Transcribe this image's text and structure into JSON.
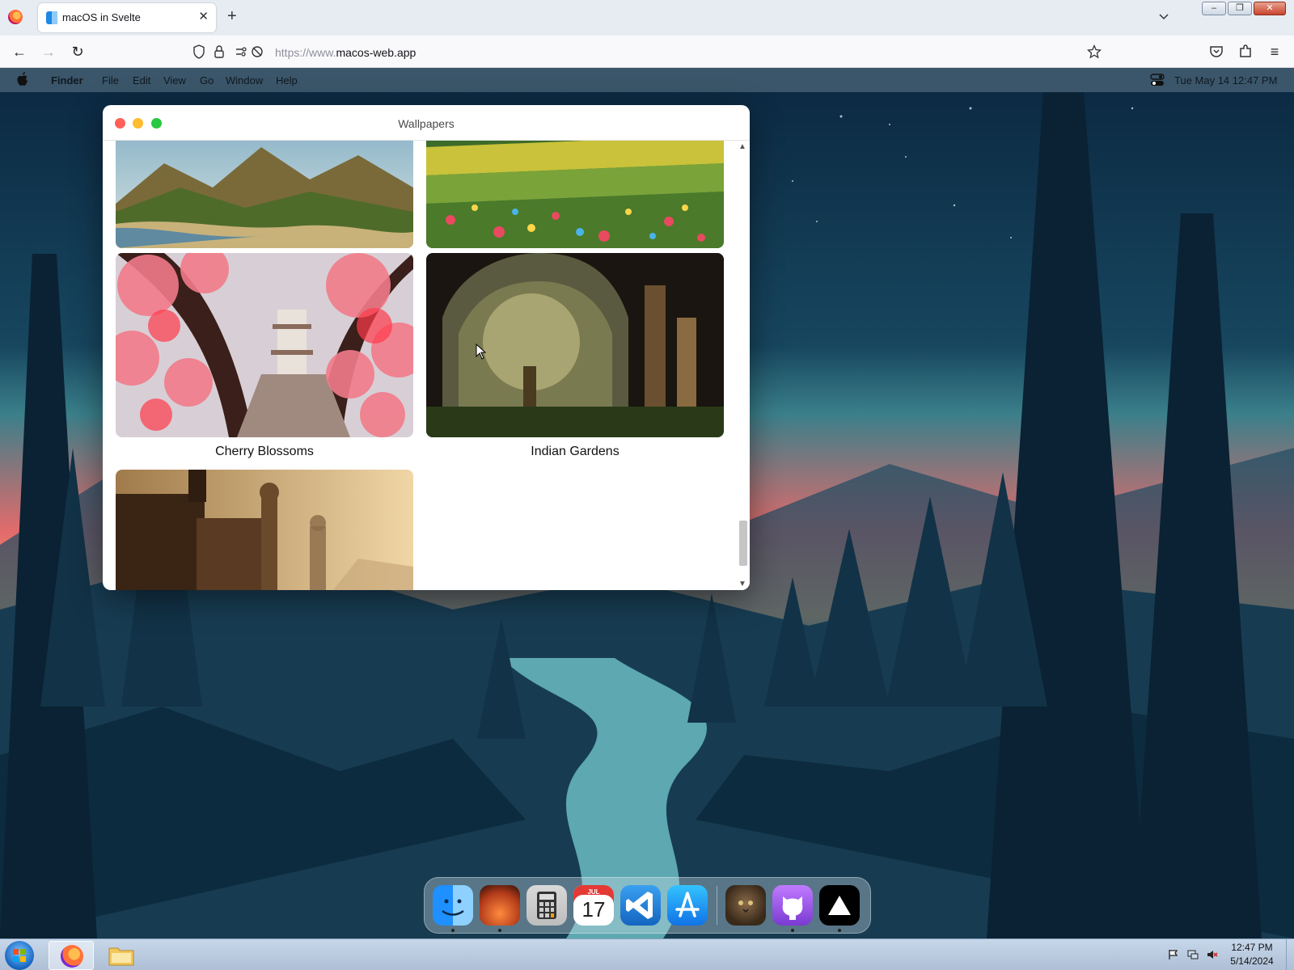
{
  "browser": {
    "tab": {
      "title": "macOS in Svelte"
    },
    "url": {
      "prefix": "https://www.",
      "domain": "macos-web.app"
    }
  },
  "menubar": {
    "app_name": "Finder",
    "menus": [
      "File",
      "Edit",
      "View",
      "Go",
      "Window",
      "Help"
    ],
    "clock": "Tue May 14  12:47 PM"
  },
  "window": {
    "title": "Wallpapers",
    "wallpapers": [
      {
        "caption": "Cherry Blossoms"
      },
      {
        "caption": "Indian Gardens"
      }
    ]
  },
  "dock": {
    "calendar": {
      "month": "JUL",
      "day": "17"
    }
  },
  "taskbar": {
    "time": "12:47 PM",
    "date": "5/14/2024"
  },
  "colors": {
    "traffic_red": "#ff5f57",
    "traffic_yellow": "#febc2e",
    "traffic_green": "#28c840"
  }
}
